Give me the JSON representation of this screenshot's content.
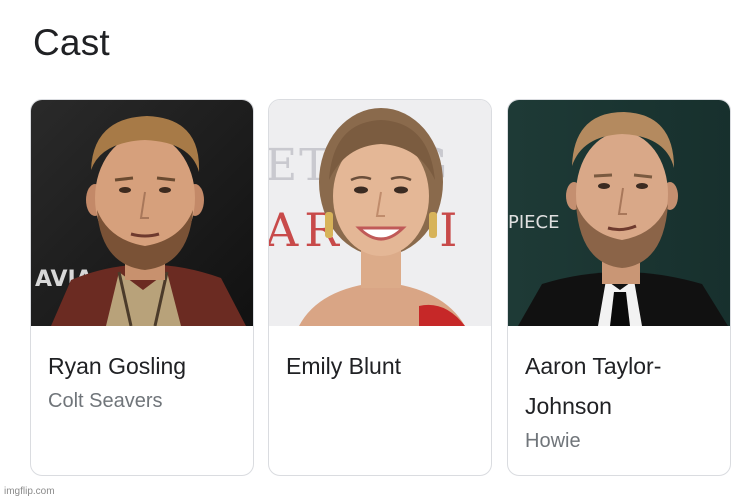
{
  "section": {
    "title": "Cast"
  },
  "cast": [
    {
      "name": "Ryan Gosling",
      "role": "Colt Seavers",
      "photo_icon": "actor-portrait-ryan-gosling",
      "backdrop_text": "AVIA"
    },
    {
      "name": "Emily Blunt",
      "role": "",
      "photo_icon": "actor-portrait-emily-blunt",
      "backdrop_text_top": "ETT AG",
      "backdrop_text_bottom": "AR M I"
    },
    {
      "name": "Aaron Taylor-Johnson",
      "name_line1": "Aaron Taylor-",
      "name_line2": "Johnson",
      "role": "Howie",
      "photo_icon": "actor-portrait-aaron-taylor-johnson",
      "backdrop_text": "PIECE"
    }
  ],
  "footer": {
    "watermark": "imgflip.com"
  },
  "colors": {
    "title": "#202124",
    "secondary": "#70757a",
    "border": "#dadce0"
  }
}
